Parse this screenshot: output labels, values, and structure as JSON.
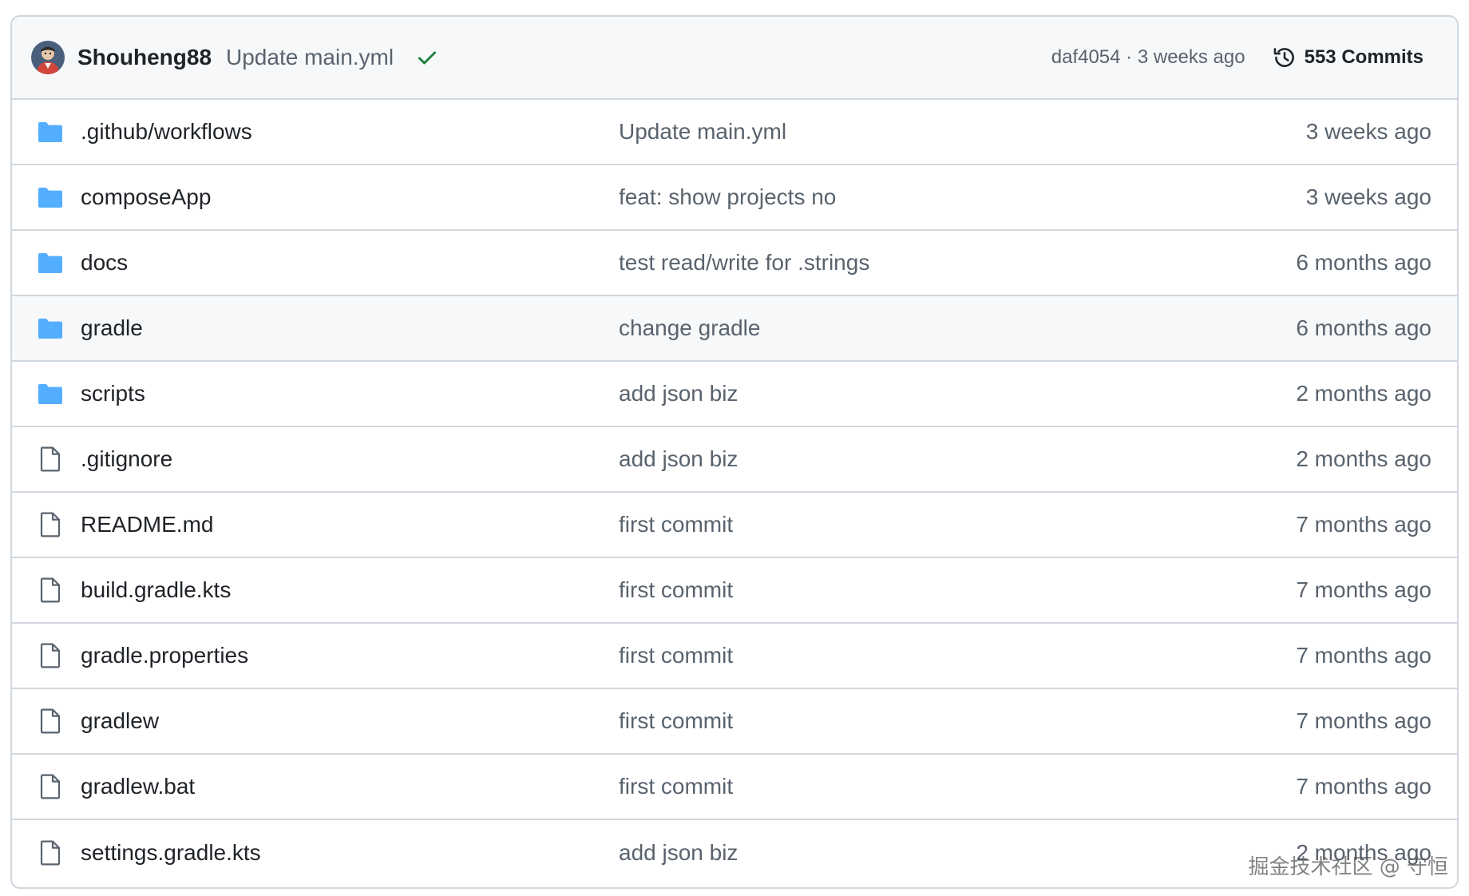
{
  "header": {
    "author": "Shouheng88",
    "commit_message": "Update main.yml",
    "status": "success",
    "commit_hash": "daf4054",
    "separator": "·",
    "commit_time": "3 weeks ago",
    "commits_label": "553 Commits"
  },
  "colors": {
    "folder": "#54aeff",
    "check": "#1a7f37",
    "border": "#d0d7de",
    "header_bg": "#f6f8fa",
    "muted_text": "#59636e"
  },
  "files": [
    {
      "type": "folder",
      "icon": "folder-icon",
      "name": ".github/workflows",
      "message": "Update main.yml",
      "date": "3 weeks ago"
    },
    {
      "type": "folder",
      "icon": "folder-icon",
      "name": "composeApp",
      "message": "feat: show projects no",
      "date": "3 weeks ago"
    },
    {
      "type": "folder",
      "icon": "folder-icon",
      "name": "docs",
      "message": "test read/write for .strings",
      "date": "6 months ago"
    },
    {
      "type": "folder",
      "icon": "folder-icon",
      "name": "gradle",
      "message": "change gradle",
      "date": "6 months ago"
    },
    {
      "type": "folder",
      "icon": "folder-icon",
      "name": "scripts",
      "message": "add json biz",
      "date": "2 months ago"
    },
    {
      "type": "file",
      "icon": "file-icon",
      "name": ".gitignore",
      "message": "add json biz",
      "date": "2 months ago"
    },
    {
      "type": "file",
      "icon": "file-icon",
      "name": "README.md",
      "message": "first commit",
      "date": "7 months ago"
    },
    {
      "type": "file",
      "icon": "file-icon",
      "name": "build.gradle.kts",
      "message": "first commit",
      "date": "7 months ago"
    },
    {
      "type": "file",
      "icon": "file-icon",
      "name": "gradle.properties",
      "message": "first commit",
      "date": "7 months ago"
    },
    {
      "type": "file",
      "icon": "file-icon",
      "name": "gradlew",
      "message": "first commit",
      "date": "7 months ago"
    },
    {
      "type": "file",
      "icon": "file-icon",
      "name": "gradlew.bat",
      "message": "first commit",
      "date": "7 months ago"
    },
    {
      "type": "file",
      "icon": "file-icon",
      "name": "settings.gradle.kts",
      "message": "add json biz",
      "date": "2 months ago"
    }
  ],
  "watermark": "掘金技术社区 @ 守恒"
}
